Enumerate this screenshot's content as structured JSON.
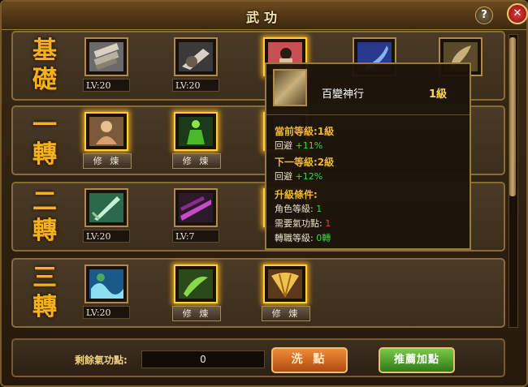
{
  "window": {
    "title": "武功"
  },
  "rows": [
    {
      "label": "基礎",
      "slots": [
        {
          "icon": "scroll-bundle-skill",
          "status": "LV:20",
          "glow": false
        },
        {
          "icon": "punch-skill",
          "status": "LV:20",
          "glow": false
        },
        {
          "icon": "fighter-skill",
          "status": "",
          "glow": true
        },
        {
          "icon": "blue-blade-skill",
          "status": "",
          "glow": false
        },
        {
          "icon": "feather-skill",
          "status": "",
          "glow": false
        }
      ]
    },
    {
      "label": "一轉",
      "slots": [
        {
          "icon": "meditating-monk-skill",
          "status": "修 煉",
          "glow": true
        },
        {
          "icon": "green-warrior-skill",
          "status": "修 煉",
          "glow": true
        },
        {
          "icon": "hidden-skill",
          "status": "",
          "glow": true
        }
      ]
    },
    {
      "label": "二轉",
      "slots": [
        {
          "icon": "green-sword-skill",
          "status": "LV:20",
          "glow": false
        },
        {
          "icon": "purple-slash-skill",
          "status": "LV:7",
          "glow": false
        },
        {
          "icon": "hidden-skill",
          "status": "",
          "glow": true
        }
      ]
    },
    {
      "label": "三轉",
      "slots": [
        {
          "icon": "water-wave-skill",
          "status": "LV:20",
          "glow": false
        },
        {
          "icon": "green-kick-skill",
          "status": "修 煉",
          "glow": true
        },
        {
          "icon": "golden-fan-skill",
          "status": "修 煉",
          "glow": true
        }
      ]
    }
  ],
  "tooltip": {
    "skill_name": "百變神行",
    "level": "1級",
    "current_header": "當前等級:1級",
    "current_stat_name": "回避",
    "current_stat_value": "+11%",
    "next_header": "下一等級:2級",
    "next_stat_name": "回避",
    "next_stat_value": "+12%",
    "req_header": "升級條件:",
    "req1_label": "角色等級:",
    "req1_value": "1",
    "req2_label": "需要氣功點:",
    "req2_value": "1",
    "req3_label": "轉職等級:",
    "req3_value": "0轉"
  },
  "bottom": {
    "points_label": "剩餘氣功點:",
    "points_value": "0",
    "reset_button": "洗 點",
    "recommend_button": "推薦加點"
  },
  "colors": {
    "gold": "#f2b21c",
    "glow": "#ffcf3a",
    "green": "#3ad83a",
    "red": "#e83a3a"
  }
}
